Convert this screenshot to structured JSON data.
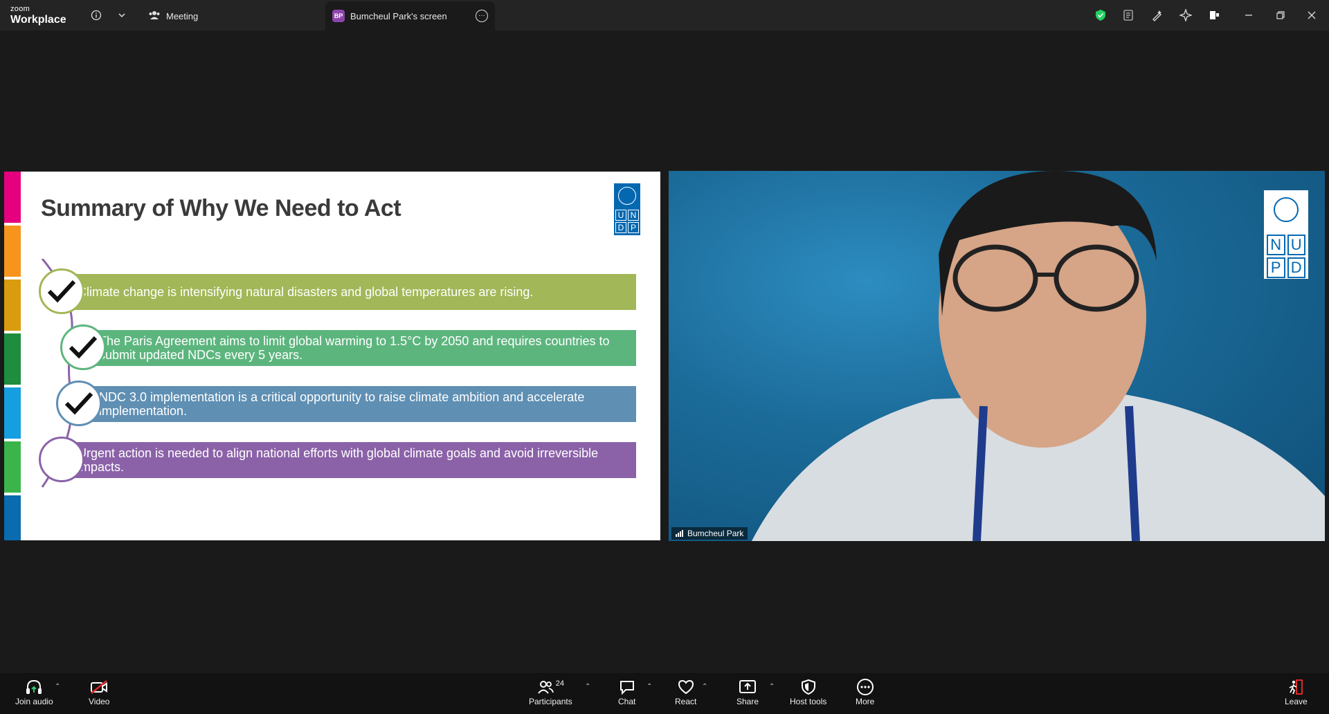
{
  "titlebar": {
    "brand_small": "zoom",
    "brand_big": "Workplace",
    "tab_meeting": "Meeting",
    "tab_screen_badge": "BP",
    "tab_screen": "Bumcheul Park's screen"
  },
  "slide": {
    "title": "Summary of Why We Need to Act",
    "logo_cells": [
      "U",
      "N",
      "D",
      "P"
    ],
    "colors": [
      "#e5007e",
      "#f7941d",
      "#d89c0e",
      "#1e8d3e",
      "#159ee0",
      "#3bb54a",
      "#0a6bae"
    ],
    "items": [
      {
        "text": "Climate change is intensifying natural disasters and global temperatures are rising.",
        "color": "#a2b757",
        "checked": true
      },
      {
        "text": "The Paris Agreement aims to limit global warming to 1.5°C by 2050 and requires countries to submit updated NDCs every 5 years.",
        "color": "#5db57e",
        "checked": true
      },
      {
        "text": "NDC 3.0 implementation is a critical opportunity to raise climate ambition and accelerate implementation.",
        "color": "#5f8fb3",
        "checked": true
      },
      {
        "text": "Urgent action is needed to align national efforts with global climate goals and avoid irreversible impacts.",
        "color": "#8b62a8",
        "checked": false
      }
    ]
  },
  "video": {
    "participant_name": "Bumcheul Park",
    "logo_cells": [
      "N",
      "U",
      "P",
      "D"
    ]
  },
  "toolbar": {
    "join_audio": "Join audio",
    "video": "Video",
    "participants": "Participants",
    "participants_count": "24",
    "chat": "Chat",
    "react": "React",
    "share": "Share",
    "host_tools": "Host tools",
    "more": "More",
    "leave": "Leave"
  }
}
